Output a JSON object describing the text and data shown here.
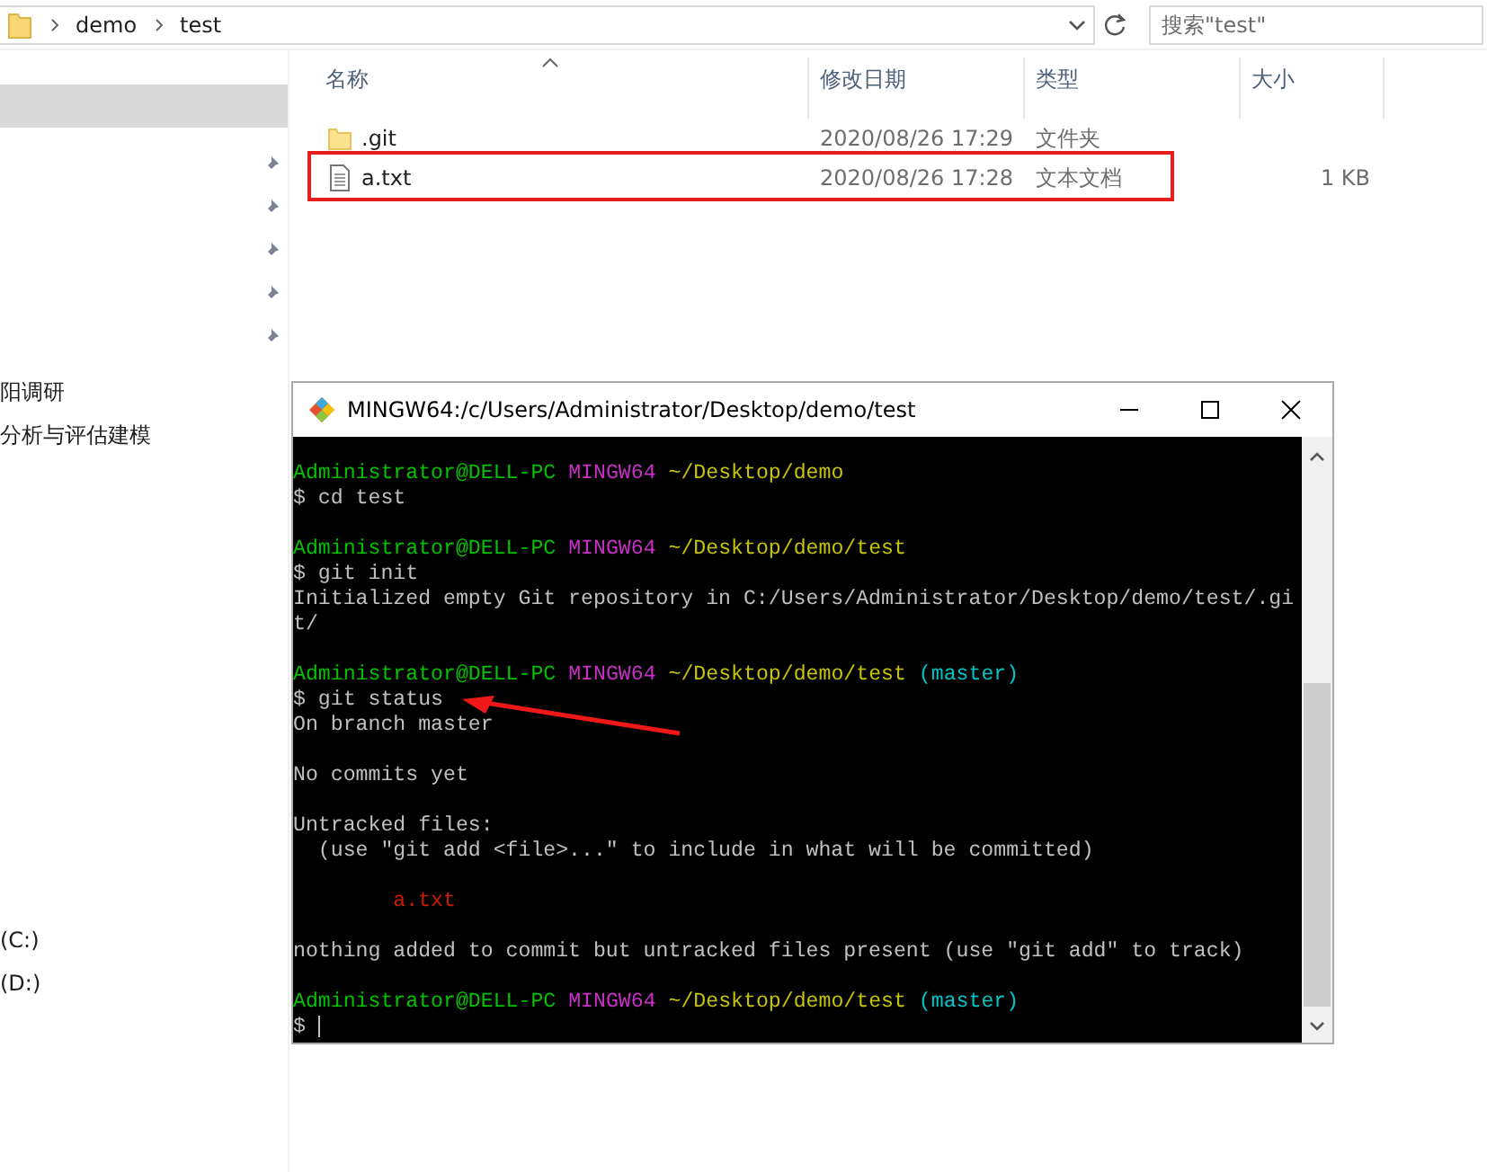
{
  "address_bar": {
    "crumbs": [
      "demo",
      "test"
    ],
    "search_placeholder": "搜索\"test\""
  },
  "nav": {
    "quick_access": [
      {
        "pinned": true
      },
      {
        "pinned": true
      },
      {
        "pinned": true
      },
      {
        "pinned": true
      },
      {
        "pinned": true
      }
    ],
    "top_items": [
      {
        "label": "阳调研"
      },
      {
        "label": "分析与评估建模"
      }
    ],
    "drive_items": [
      {
        "label": "(C:)"
      },
      {
        "label": "(D:)"
      }
    ]
  },
  "file_list": {
    "columns": [
      "名称",
      "修改日期",
      "类型",
      "大小"
    ],
    "rows": [
      {
        "kind": "folder",
        "name": ".git",
        "date": "2020/08/26 17:29",
        "type": "文件夹"
      },
      {
        "kind": "file",
        "name": "a.txt",
        "date": "2020/08/26 17:28",
        "type": "文本文档",
        "size": "1 KB"
      }
    ]
  },
  "terminal": {
    "title": "MINGW64:/c/Users/Administrator/Desktop/demo/test",
    "blocks": [
      {
        "lines": [
          {
            "segments": [
              {
                "kind": "user",
                "text": "Administrator@DELL-PC"
              },
              {
                "kind": "host",
                "text": "MINGW64"
              },
              {
                "kind": "path",
                "text": "~/Desktop/demo"
              }
            ]
          },
          {
            "segments": [
              {
                "kind": "text",
                "text": "$ cd test"
              }
            ]
          }
        ]
      },
      {
        "lines": [
          {
            "segments": [
              {
                "kind": "user",
                "text": "Administrator@DELL-PC"
              },
              {
                "kind": "host",
                "text": "MINGW64"
              },
              {
                "kind": "path",
                "text": "~/Desktop/demo/test"
              }
            ]
          },
          {
            "segments": [
              {
                "kind": "text",
                "text": "$ git init"
              }
            ]
          },
          {
            "segments": [
              {
                "kind": "text",
                "text": "Initialized empty Git repository in C:/Users/Administrator/Desktop/demo/test/.gi"
              }
            ]
          },
          {
            "segments": [
              {
                "kind": "text",
                "text": "t/"
              }
            ]
          }
        ]
      },
      {
        "lines": [
          {
            "segments": [
              {
                "kind": "user",
                "text": "Administrator@DELL-PC"
              },
              {
                "kind": "host",
                "text": "MINGW64"
              },
              {
                "kind": "path",
                "text": "~/Desktop/demo/test"
              },
              {
                "kind": "branch",
                "text": "(master)"
              }
            ]
          },
          {
            "segments": [
              {
                "kind": "text",
                "text": "$ git status"
              }
            ]
          },
          {
            "segments": [
              {
                "kind": "text",
                "text": "On branch master"
              }
            ]
          }
        ]
      },
      {
        "lines": [
          {
            "segments": [
              {
                "kind": "text",
                "text": "No commits yet"
              }
            ]
          }
        ]
      },
      {
        "lines": [
          {
            "segments": [
              {
                "kind": "text",
                "text": "Untracked files:"
              }
            ]
          },
          {
            "segments": [
              {
                "kind": "text",
                "text": "  (use \"git add <file>...\" to include in what will be committed)"
              }
            ]
          }
        ]
      },
      {
        "lines": [
          {
            "segments": [
              {
                "kind": "untracked",
                "text": "        a.txt"
              }
            ]
          }
        ]
      },
      {
        "lines": [
          {
            "segments": [
              {
                "kind": "text",
                "text": "nothing added to commit but untracked files present (use \"git add\" to track)"
              }
            ]
          }
        ]
      },
      {
        "lines": [
          {
            "segments": [
              {
                "kind": "user",
                "text": "Administrator@DELL-PC"
              },
              {
                "kind": "host",
                "text": "MINGW64"
              },
              {
                "kind": "path",
                "text": "~/Desktop/demo/test"
              },
              {
                "kind": "branch",
                "text": "(master)"
              }
            ]
          },
          {
            "cursor": true,
            "segments": [
              {
                "kind": "text",
                "text": "$"
              }
            ]
          }
        ]
      }
    ]
  }
}
